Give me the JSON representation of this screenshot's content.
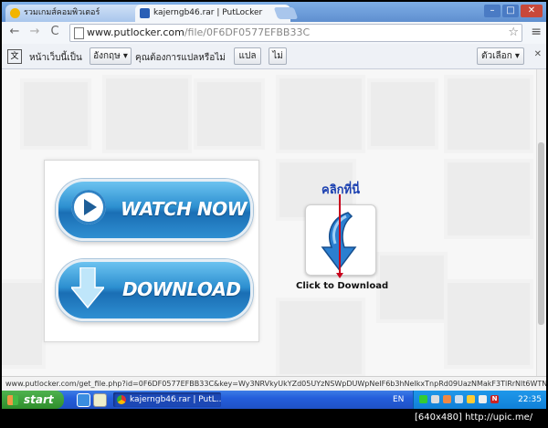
{
  "tabs": [
    {
      "label": "รวมเกมส์คอมพิวเตอร์",
      "active": false
    },
    {
      "label": "kajerngb46.rar | PutLocker",
      "active": true
    }
  ],
  "window_controls": {
    "minimize": "–",
    "maximize": "□",
    "close": "✕"
  },
  "nav": {
    "back": "←",
    "forward": "→",
    "reload": "C"
  },
  "address_bar": {
    "domain": "www.putlocker.com",
    "path": "/file/0F6DF0577EFBB33C"
  },
  "translate_bar": {
    "prefix": "หน้าเว็บนี้เป็น",
    "language": "อังกฤษ",
    "question": "คุณต้องการแปลหรือไม่",
    "translate_label": "แปล",
    "no_label": "ไม่",
    "options_label": "ตัวเลือก"
  },
  "page": {
    "watch_now_label": "WATCH NOW",
    "download_label": "DOWNLOAD",
    "click_here_label": "คลิกที่นี่",
    "click_to_download_label": "Click to Download"
  },
  "status_url": "www.putlocker.com/get_file.php?id=0F6DF0577EFBB33C&key=Wy3NRVkyUkYZd05UYzNSWpDUWpNeIF6b3hNeIkxTnpRd09UazNMakF3TlRrNlt6WTNOekUxW...",
  "taskbar": {
    "start_label": "start",
    "task_label": "kajerngb46.rar | PutL...",
    "language": "EN",
    "clock": "22:35"
  },
  "watermark": "[640x480] http://upic.me/",
  "colors": {
    "accent_blue": "#2c8fd0",
    "pointer_red": "#c8001c",
    "click_here_blue": "#1a3fb0"
  }
}
